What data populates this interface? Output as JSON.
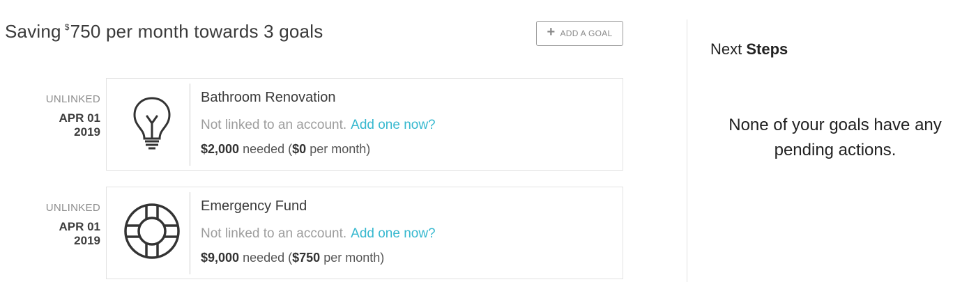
{
  "header": {
    "title_prefix": "Saving",
    "currency_symbol": "$",
    "amount": "750",
    "title_suffix": "per month towards 3 goals",
    "add_goal_label": "ADD A GOAL"
  },
  "goals": [
    {
      "status": "UNLINKED",
      "date_day": "APR 01",
      "date_year": "2019",
      "icon": "lightbulb-icon",
      "name": "Bathroom Renovation",
      "link_text": "Not linked to an account.",
      "link_action": "Add one now?",
      "needed_amount": "$2,000",
      "needed_label": "needed (",
      "monthly_amount": "$0",
      "monthly_label": "per month)"
    },
    {
      "status": "UNLINKED",
      "date_day": "APR 01",
      "date_year": "2019",
      "icon": "life-preserver-icon",
      "name": "Emergency Fund",
      "link_text": "Not linked to an account.",
      "link_action": "Add one now?",
      "needed_amount": "$9,000",
      "needed_label": "needed (",
      "monthly_amount": "$750",
      "monthly_label": "per month)"
    }
  ],
  "next_steps": {
    "title_light": "Next",
    "title_bold": "Steps",
    "message": "None of your goals have any pending actions."
  },
  "colors": {
    "link": "#36b8cf",
    "text_dark": "#333333",
    "text_muted": "#9d9d9d",
    "card_border": "#e2e2e2"
  }
}
